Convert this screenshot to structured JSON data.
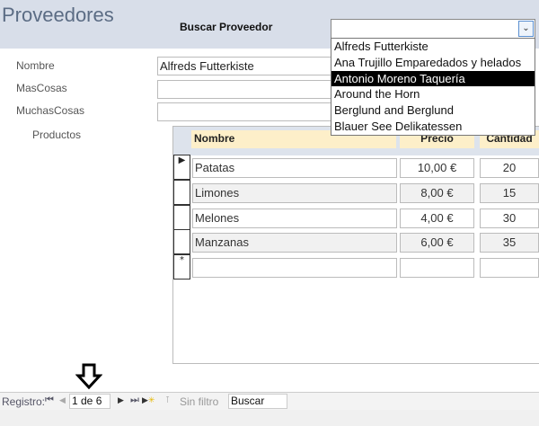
{
  "form": {
    "title": "Proveedores",
    "search_label": "Buscar Proveedor",
    "search_value": "",
    "dropdown": [
      "Alfreds Futterkiste",
      "Ana Trujillo Emparedados y helados",
      "Antonio Moreno Taquería",
      "Around the Horn",
      "Berglund and Berglund",
      "Blauer See Delikatessen"
    ],
    "fields": [
      {
        "label": "Nombre",
        "value": "Alfreds Futterkiste"
      },
      {
        "label": "MasCosas",
        "value": ""
      },
      {
        "label": "MuchasCosas",
        "value": ""
      }
    ],
    "subform_label": "Productos"
  },
  "products": {
    "headers": [
      "Nombre",
      "Precio",
      "Cantidad"
    ],
    "rows": [
      [
        "Patatas",
        "10,00 €",
        "20"
      ],
      [
        "Limones",
        "8,00 €",
        "15"
      ],
      [
        "Melones",
        "4,00 €",
        "30"
      ],
      [
        "Manzanas",
        "6,00 €",
        "35"
      ]
    ],
    "new_row_symbol": "*"
  },
  "nav": {
    "label": "Registro:",
    "record": "1 de 6",
    "filter": "Sin filtro",
    "search": "Buscar"
  }
}
